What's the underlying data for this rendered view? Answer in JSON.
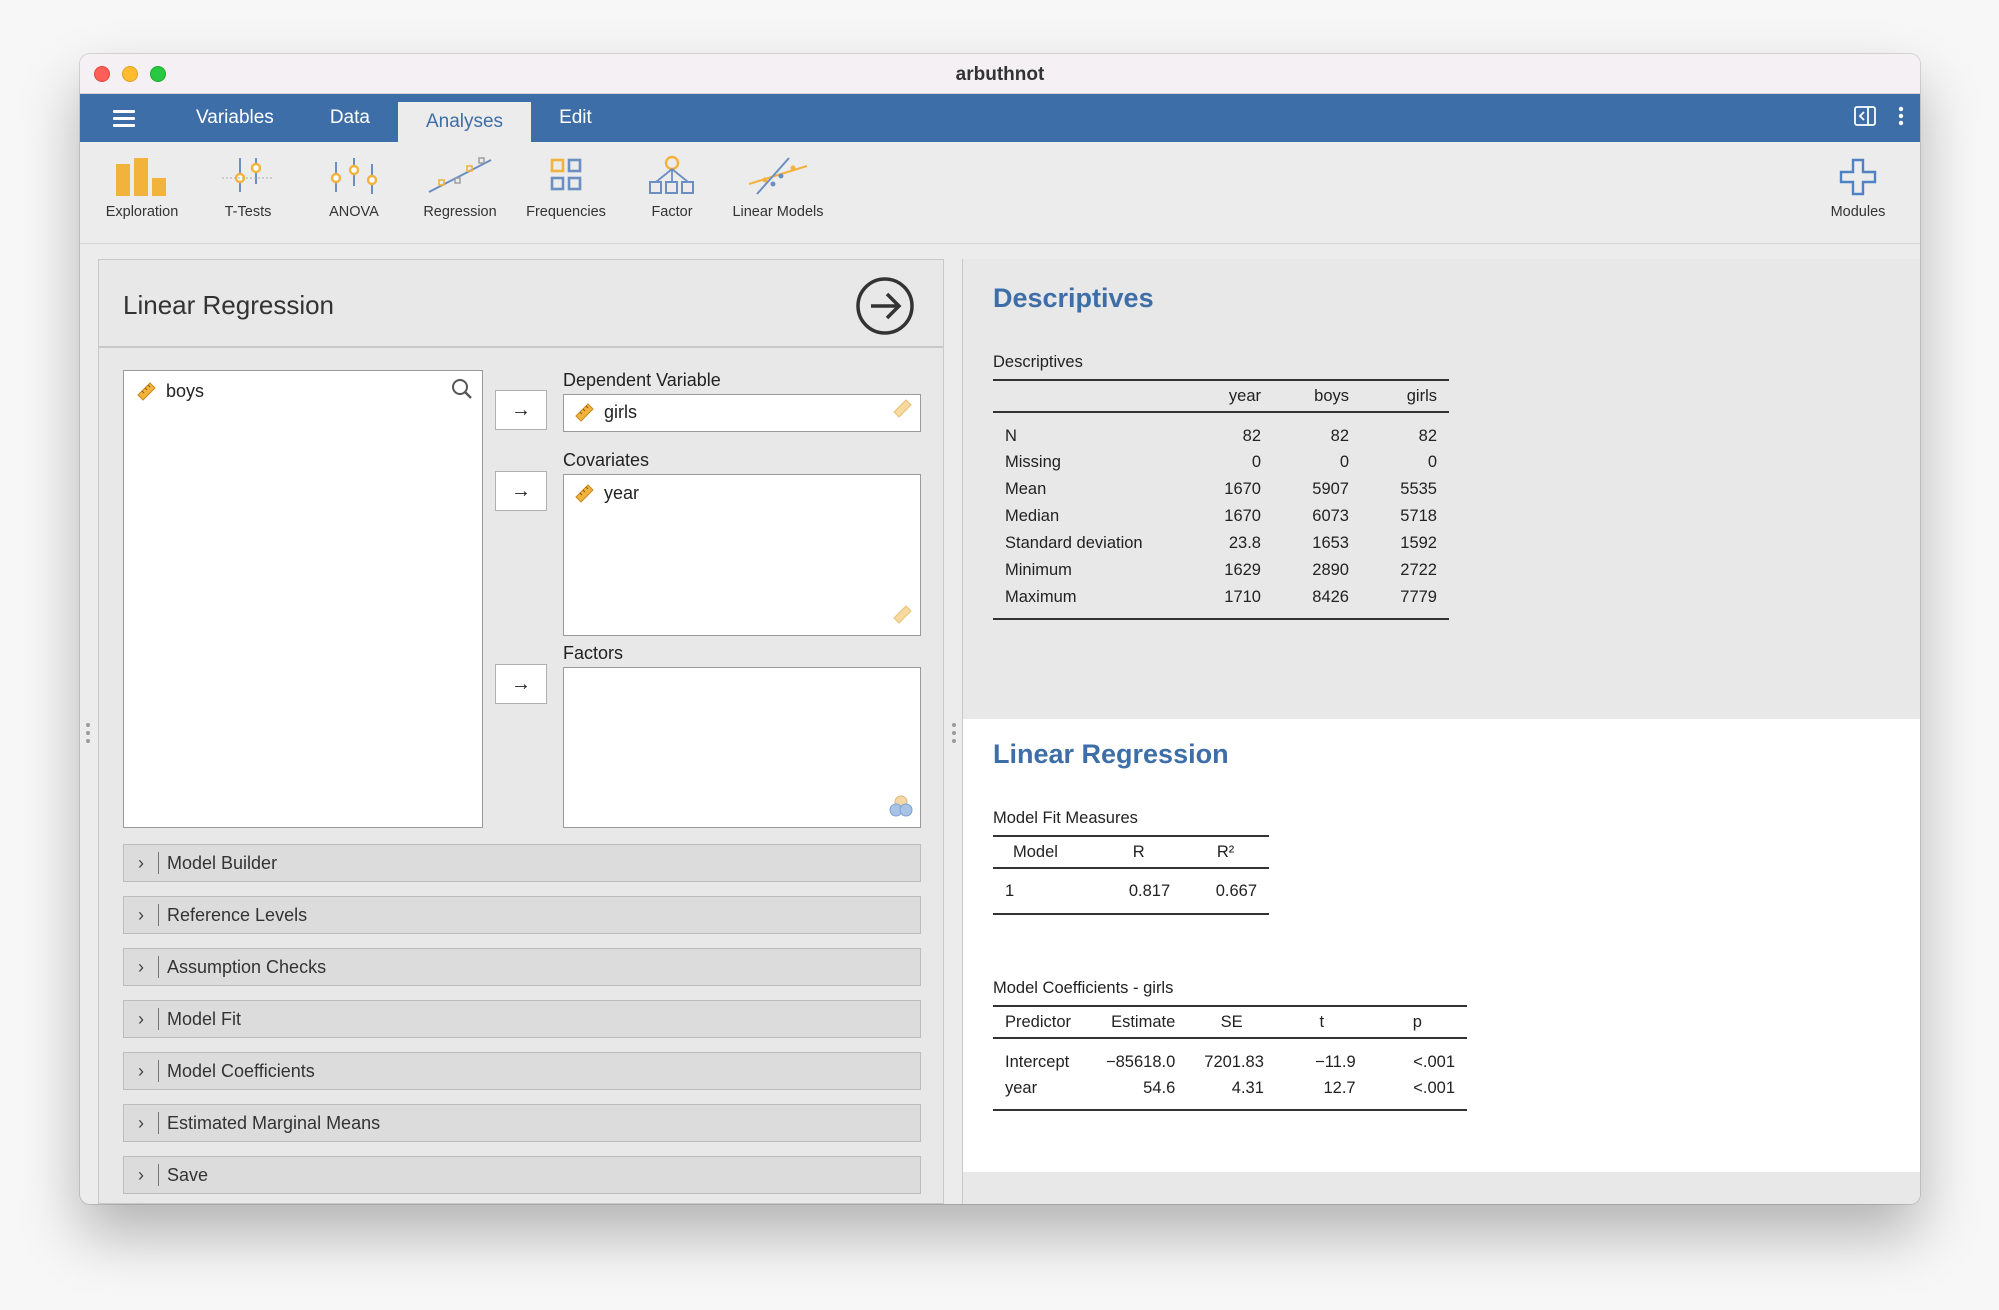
{
  "window": {
    "title": "arbuthnot"
  },
  "menu": {
    "tabs": [
      "Variables",
      "Data",
      "Analyses",
      "Edit"
    ],
    "active": "Analyses"
  },
  "toolbar": {
    "items": [
      {
        "label": "Exploration",
        "icon": "exploration-icon"
      },
      {
        "label": "T-Tests",
        "icon": "t-tests-icon"
      },
      {
        "label": "ANOVA",
        "icon": "anova-icon"
      },
      {
        "label": "Regression",
        "icon": "regression-icon"
      },
      {
        "label": "Frequencies",
        "icon": "frequencies-icon"
      },
      {
        "label": "Factor",
        "icon": "factor-icon"
      },
      {
        "label": "Linear Models",
        "icon": "linear-models-icon"
      }
    ],
    "modules_label": "Modules"
  },
  "colors": {
    "accent": "#3e6ea8",
    "variable_icon": "#f2b33d"
  },
  "options": {
    "title": "Linear Regression",
    "available_variables": [
      "boys"
    ],
    "dependent_label": "Dependent Variable",
    "dependent_value": "girls",
    "covariates_label": "Covariates",
    "covariates": [
      "year"
    ],
    "factors_label": "Factors",
    "factors": [],
    "sections": [
      "Model Builder",
      "Reference Levels",
      "Assumption Checks",
      "Model Fit",
      "Model Coefficients",
      "Estimated Marginal Means",
      "Save"
    ]
  },
  "results": {
    "descriptives": {
      "heading": "Descriptives",
      "caption": "Descriptives",
      "columns": [
        "",
        "year",
        "boys",
        "girls"
      ],
      "rows": [
        [
          "N",
          "82",
          "82",
          "82"
        ],
        [
          "Missing",
          "0",
          "0",
          "0"
        ],
        [
          "Mean",
          "1670",
          "5907",
          "5535"
        ],
        [
          "Median",
          "1670",
          "6073",
          "5718"
        ],
        [
          "Standard deviation",
          "23.8",
          "1653",
          "1592"
        ],
        [
          "Minimum",
          "1629",
          "2890",
          "2722"
        ],
        [
          "Maximum",
          "1710",
          "8426",
          "7779"
        ]
      ]
    },
    "regression": {
      "heading": "Linear Regression",
      "model_fit": {
        "caption": "Model Fit Measures",
        "columns": [
          "Model",
          "R",
          "R²"
        ],
        "rows": [
          [
            "1",
            "0.817",
            "0.667"
          ]
        ]
      },
      "coefficients": {
        "caption": "Model Coefficients - girls",
        "columns": [
          "Predictor",
          "Estimate",
          "SE",
          "t",
          "p"
        ],
        "rows": [
          [
            "Intercept",
            "−85618.0",
            "7201.83",
            "−11.9",
            "<.001"
          ],
          [
            "year",
            "54.6",
            "4.31",
            "12.7",
            "<.001"
          ]
        ]
      }
    }
  }
}
